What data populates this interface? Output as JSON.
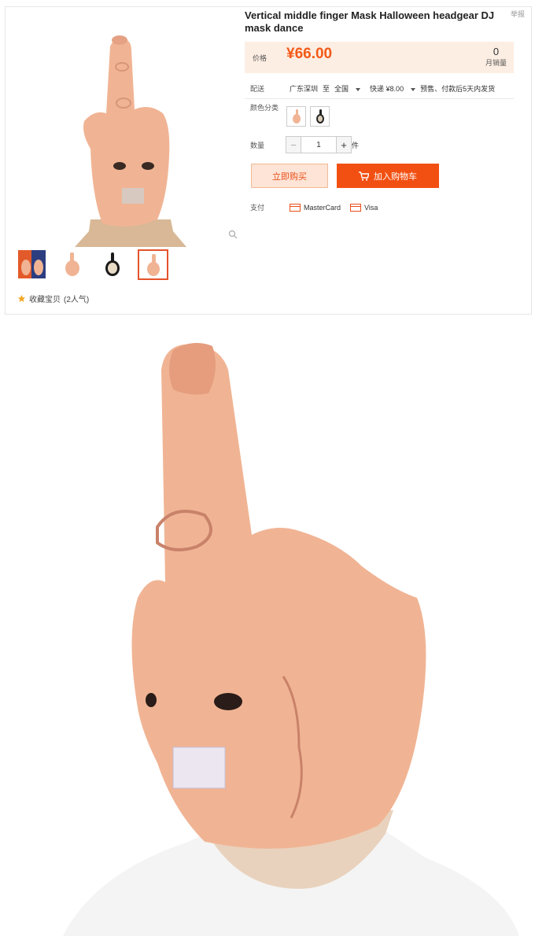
{
  "report_label": "举报",
  "product": {
    "title": "Vertical middle finger Mask Halloween headgear DJ mask dance",
    "price_label": "价格",
    "price": "¥66.00",
    "monthly_sales_value": "0",
    "monthly_sales_label": "月销量",
    "shipping": {
      "label": "配送",
      "origin": "广东深圳",
      "to": "至",
      "destination": "全国",
      "express": "快递 ¥8.00",
      "note": "预售、付款后5天内发货"
    },
    "color_label": "颜色分类",
    "quantity_label": "数量",
    "quantity_minus": "−",
    "quantity_value": "1",
    "quantity_plus": "+",
    "quantity_unit": "件",
    "buy_now": "立即购买",
    "add_to_cart": "加入购物车",
    "payment_label": "支付",
    "payment_methods": [
      "MasterCard",
      "Visa"
    ],
    "favorite": "收藏宝贝",
    "favorite_count": "(2人气)"
  },
  "colors": {
    "accent": "#f25012",
    "price": "#f25a17",
    "price_bg": "#fdeee3",
    "star": "#f5a623"
  }
}
